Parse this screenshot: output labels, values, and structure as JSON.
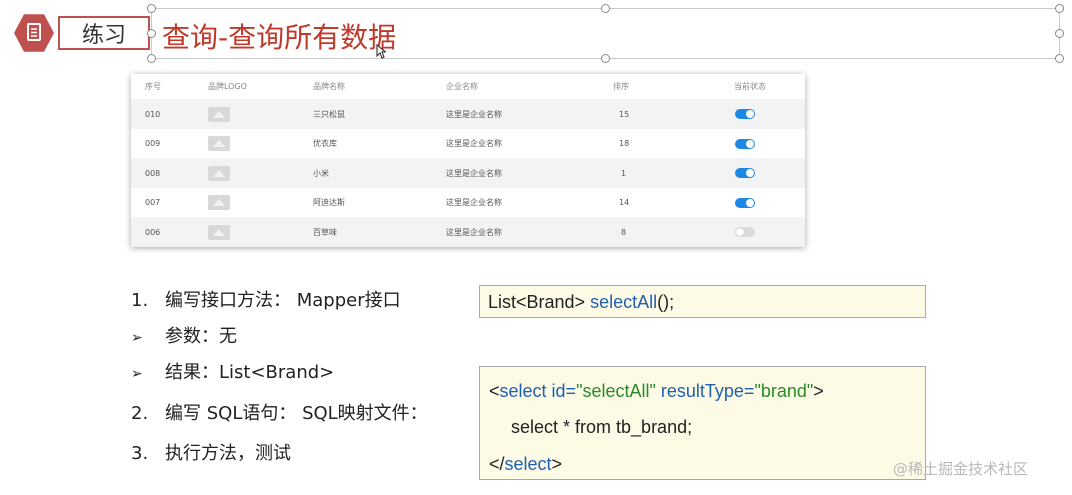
{
  "header": {
    "badge_label": "练习",
    "title": "查询-查询所有数据"
  },
  "table": {
    "columns": [
      "序号",
      "品牌LOGO",
      "品牌名称",
      "企业名称",
      "排序",
      "当前状态"
    ],
    "rows": [
      {
        "id": "010",
        "brand": "三只松鼠",
        "company": "这里是企业名称",
        "order": "15",
        "enabled": true
      },
      {
        "id": "009",
        "brand": "优衣库",
        "company": "这里是企业名称",
        "order": "18",
        "enabled": true
      },
      {
        "id": "008",
        "brand": "小米",
        "company": "这里是企业名称",
        "order": "1",
        "enabled": true
      },
      {
        "id": "007",
        "brand": "阿迪达斯",
        "company": "这里是企业名称",
        "order": "14",
        "enabled": true
      },
      {
        "id": "006",
        "brand": "百草味",
        "company": "这里是企业名称",
        "order": "8",
        "enabled": false
      }
    ]
  },
  "steps": [
    {
      "marker": "1.",
      "text": "编写接口方法： Mapper接口"
    },
    {
      "marker": "➢",
      "text": "参数：无"
    },
    {
      "marker": "➢",
      "text": "结果：List<Brand>"
    },
    {
      "marker": "2.",
      "text": "编写 SQL语句： SQL映射文件："
    },
    {
      "marker": "3.",
      "text": "执行方法，测试"
    }
  ],
  "code1": {
    "prefix": "List<Brand> ",
    "method": "selectAll",
    "suffix": "();"
  },
  "code2": {
    "open_bracket": "<",
    "tag": "select",
    "attr1_name": " id=",
    "attr1_value": "\"selectAll\"",
    "attr2_name": " resultType=",
    "attr2_value": "\"brand\"",
    "close_bracket": ">",
    "sql": "select * from tb_brand;",
    "end_open": "</",
    "end_tag": "select",
    "end_close": ">"
  },
  "watermark": "@稀土掘金技术社区",
  "colors": {
    "accent": "#c0504d",
    "title": "#c0392b",
    "code_bg": "#fdfbe6",
    "keyword": "#2060b0",
    "string": "#2a8a2a",
    "toggle_on": "#1e88e5"
  }
}
